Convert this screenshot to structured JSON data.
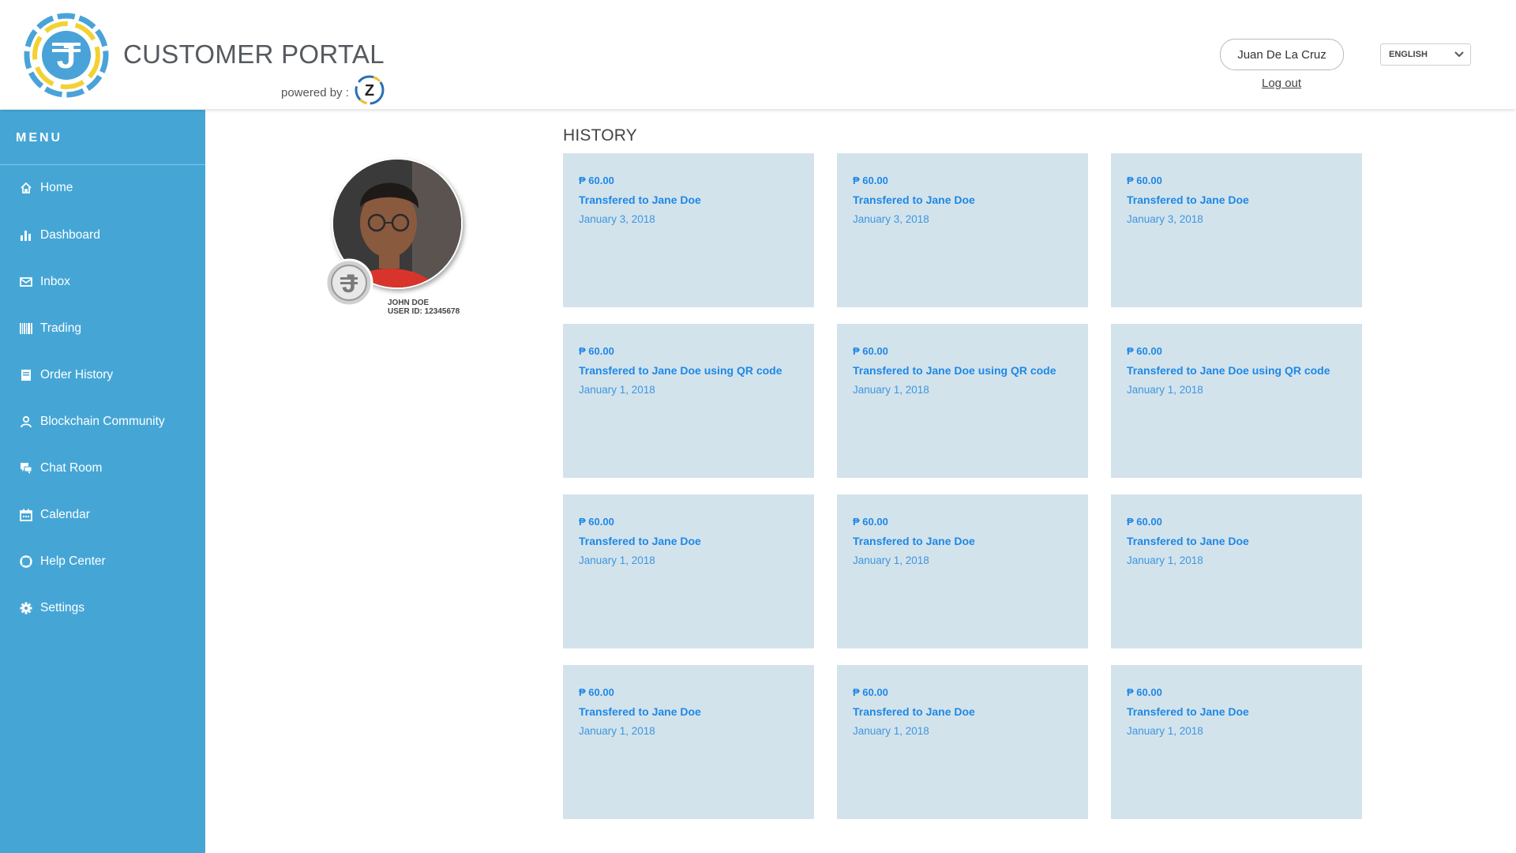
{
  "header": {
    "title": "CUSTOMER PORTAL",
    "powered_by": "powered by :",
    "user_name": "Juan De La Cruz",
    "logout": "Log out",
    "language": "ENGLISH"
  },
  "sidebar": {
    "menu_label": "MENU",
    "items": [
      {
        "label": "Home",
        "icon": "home-icon"
      },
      {
        "label": "Dashboard",
        "icon": "bar-chart-icon"
      },
      {
        "label": "Inbox",
        "icon": "envelope-icon"
      },
      {
        "label": "Trading",
        "icon": "barcode-icon"
      },
      {
        "label": "Order History",
        "icon": "receipt-icon"
      },
      {
        "label": "Blockchain Community",
        "icon": "person-icon"
      },
      {
        "label": "Chat Room",
        "icon": "chat-icon"
      },
      {
        "label": "Calendar",
        "icon": "calendar-icon"
      },
      {
        "label": "Help Center",
        "icon": "lifebuoy-icon"
      },
      {
        "label": "Settings",
        "icon": "gear-icon"
      }
    ]
  },
  "profile": {
    "name": "JOHN DOE",
    "user_id": "USER ID: 12345678"
  },
  "history": {
    "title": "HISTORY",
    "cards": [
      {
        "amount": "₱ 60.00",
        "description": "Transfered to Jane Doe",
        "date": "January 3, 2018"
      },
      {
        "amount": "₱ 60.00",
        "description": "Transfered to Jane Doe",
        "date": "January 3, 2018"
      },
      {
        "amount": "₱ 60.00",
        "description": "Transfered to Jane Doe",
        "date": "January 3, 2018"
      },
      {
        "amount": "₱ 60.00",
        "description": "Transfered to Jane Doe using QR code",
        "date": "January 1, 2018"
      },
      {
        "amount": "₱ 60.00",
        "description": "Transfered to Jane Doe using QR code",
        "date": "January 1, 2018"
      },
      {
        "amount": "₱ 60.00",
        "description": "Transfered to Jane Doe using QR code",
        "date": "January 1, 2018"
      },
      {
        "amount": "₱ 60.00",
        "description": "Transfered to Jane Doe",
        "date": "January 1, 2018"
      },
      {
        "amount": "₱ 60.00",
        "description": "Transfered to Jane Doe",
        "date": "January 1, 2018"
      },
      {
        "amount": "₱ 60.00",
        "description": "Transfered to Jane Doe",
        "date": "January 1, 2018"
      },
      {
        "amount": "₱ 60.00",
        "description": "Transfered to Jane Doe",
        "date": "January 1, 2018"
      },
      {
        "amount": "₱ 60.00",
        "description": "Transfered to Jane Doe",
        "date": "January 1, 2018"
      },
      {
        "amount": "₱ 60.00",
        "description": "Transfered to Jane Doe",
        "date": "January 1, 2018"
      }
    ]
  },
  "colors": {
    "sidebar": "#45a6d6",
    "card_bg": "#d3e3ec",
    "card_text": "#1e88e5"
  }
}
